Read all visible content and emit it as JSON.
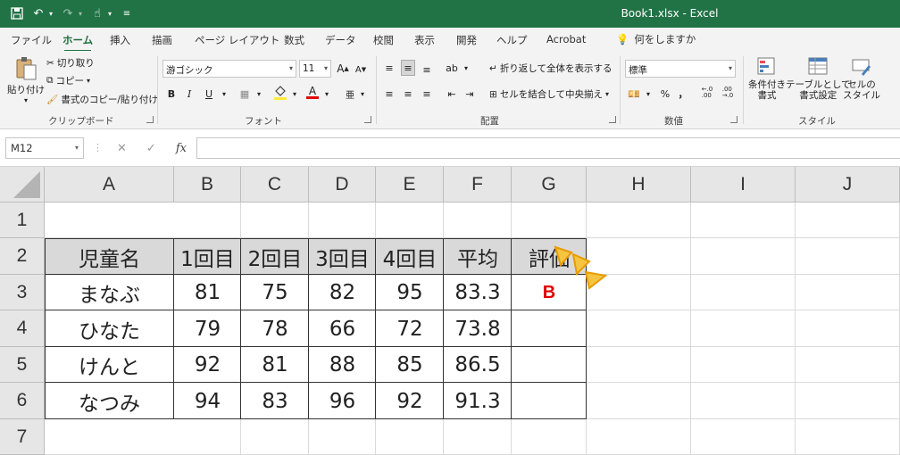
{
  "window": {
    "title": "Book1.xlsx  -  Excel"
  },
  "qat": {
    "save_icon": "save-icon",
    "undo_icon": "undo-icon",
    "redo_icon": "redo-icon",
    "touch_icon": "touch-mode-icon",
    "customize_icon": "customize-qat-icon"
  },
  "tabs": [
    "ファイル",
    "ホーム",
    "挿入",
    "描画",
    "ページ レイアウト",
    "数式",
    "データ",
    "校閲",
    "表示",
    "開発",
    "ヘルプ",
    "Acrobat"
  ],
  "tell_me": "何をしますか",
  "clipboard": {
    "paste": "貼り付け",
    "cut": "切り取り",
    "copy": "コピー",
    "format_painter": "書式のコピー/貼り付け",
    "label": "クリップボード"
  },
  "font": {
    "name": "游ゴシック",
    "size": "11",
    "grow": "A",
    "shrink": "A",
    "bold": "B",
    "italic": "I",
    "underline": "U",
    "font_color": "A",
    "label": "フォント"
  },
  "alignment": {
    "wrap": "折り返して全体を表示する",
    "merge": "セルを結合して中央揃え",
    "label": "配置"
  },
  "number": {
    "format": "標準",
    "percent": "%",
    "comma": "，",
    "inc_decimal": "←.0\n.00",
    "dec_decimal": ".00\n→.0",
    "label": "数値"
  },
  "styles": {
    "conditional": "条件付き\n書式",
    "table": "テーブルとして\n書式設定",
    "cell": "セルの\nスタイル",
    "label": "スタイル"
  },
  "formula_bar": {
    "name_box": "M12",
    "fx": "fx",
    "content": ""
  },
  "columns": [
    "A",
    "B",
    "C",
    "D",
    "E",
    "F",
    "G",
    "H",
    "I",
    "J"
  ],
  "rows": [
    "1",
    "2",
    "3",
    "4",
    "5",
    "6",
    "7"
  ],
  "table": {
    "headers": [
      "児童名",
      "1回目",
      "2回目",
      "3回目",
      "4回目",
      "平均",
      "評価"
    ],
    "rows": [
      [
        "まなぶ",
        "81",
        "75",
        "82",
        "95",
        "83.3",
        "B"
      ],
      [
        "ひなた",
        "79",
        "78",
        "66",
        "72",
        "73.8",
        ""
      ],
      [
        "けんと",
        "92",
        "81",
        "88",
        "85",
        "86.5",
        ""
      ],
      [
        "なつみ",
        "94",
        "83",
        "96",
        "92",
        "91.3",
        ""
      ]
    ]
  },
  "colors": {
    "excel_green": "#217346",
    "header_fill": "#d9d9d9",
    "grade_red": "#e00000",
    "highlight": "#f5c542"
  }
}
